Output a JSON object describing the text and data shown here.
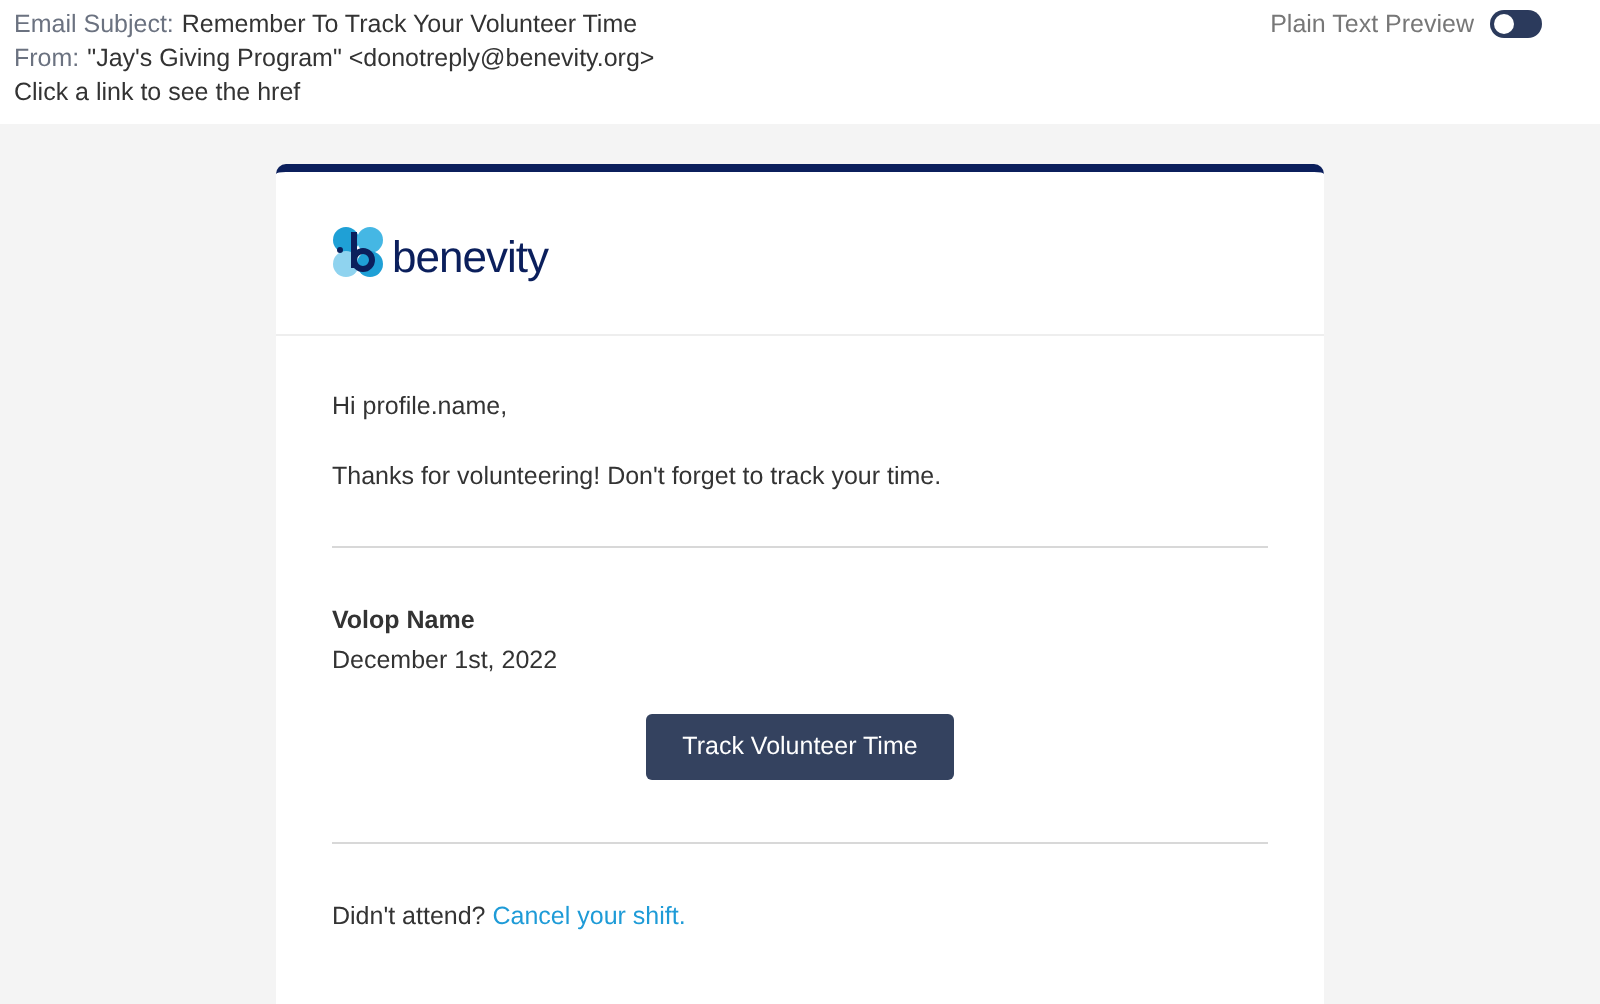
{
  "header": {
    "subject": {
      "label": "Email Subject:",
      "value": "Remember To Track Your Volunteer Time"
    },
    "from": {
      "label": "From:",
      "value": "\"Jay's Giving Program\" <donotreply@benevity.org>"
    },
    "hint": "Click a link to see the href",
    "plain_text_preview": {
      "label": "Plain Text Preview",
      "on": false
    }
  },
  "email": {
    "logo": {
      "text": "benevity"
    },
    "greeting": "Hi profile.name,",
    "message": "Thanks for volunteering! Don't forget to track your time.",
    "event": {
      "name": "Volop Name",
      "date": "December 1st, 2022"
    },
    "button": "Track Volunteer Time",
    "footer": {
      "text": "Didn't attend?",
      "link": "Cancel your shift."
    }
  }
}
